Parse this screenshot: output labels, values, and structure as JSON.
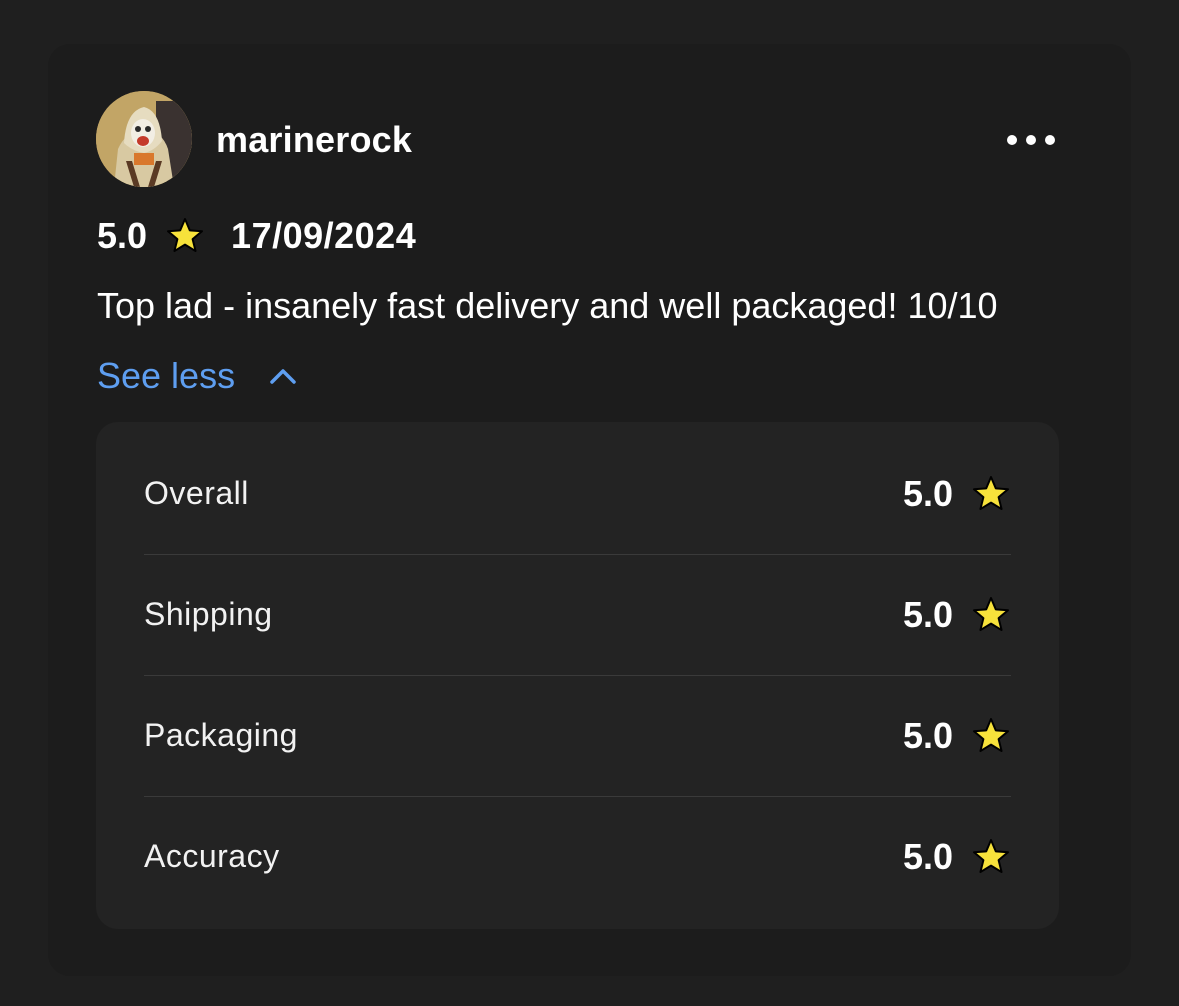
{
  "review": {
    "username": "marinerock",
    "rating": "5.0",
    "date": "17/09/2024",
    "text": "Top lad - insanely fast delivery and well packaged! 10/10",
    "see_less_label": "See less"
  },
  "breakdown": [
    {
      "label": "Overall",
      "value": "5.0"
    },
    {
      "label": "Shipping",
      "value": "5.0"
    },
    {
      "label": "Packaging",
      "value": "5.0"
    },
    {
      "label": "Accuracy",
      "value": "5.0"
    }
  ],
  "icons": {
    "more": "more-horizontal-icon",
    "star": "star-icon",
    "chevron": "chevron-up-icon"
  },
  "colors": {
    "star": "#f7e23b",
    "link": "#5e9ef0",
    "card_bg": "#1c1c1c",
    "panel_bg": "#232323"
  }
}
